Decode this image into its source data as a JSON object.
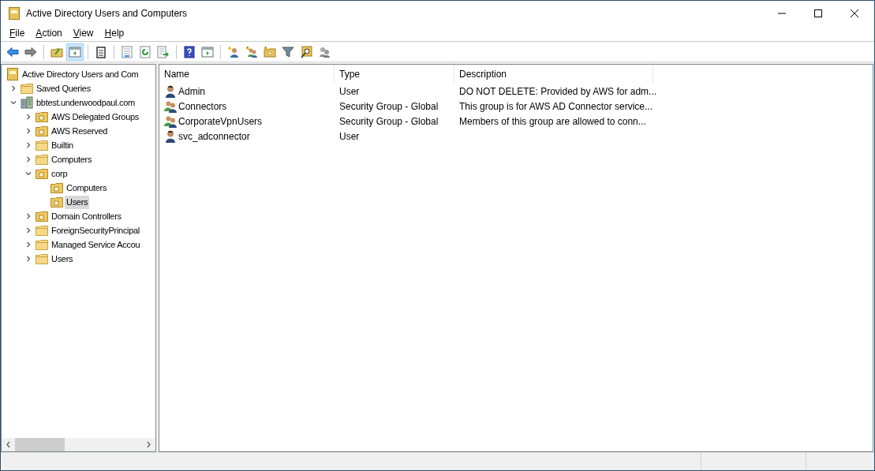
{
  "window": {
    "title": "Active Directory Users and Computers"
  },
  "menu": [
    "File",
    "Action",
    "View",
    "Help"
  ],
  "toolbar": [
    {
      "kind": "back",
      "selected": false
    },
    {
      "kind": "forward",
      "selected": false
    },
    {
      "kind": "sep"
    },
    {
      "kind": "up-folder",
      "selected": false
    },
    {
      "kind": "pane",
      "selected": true
    },
    {
      "kind": "sep"
    },
    {
      "kind": "clipboard",
      "selected": false
    },
    {
      "kind": "sep"
    },
    {
      "kind": "properties",
      "selected": false
    },
    {
      "kind": "refresh",
      "selected": false
    },
    {
      "kind": "export",
      "selected": false
    },
    {
      "kind": "sep"
    },
    {
      "kind": "help",
      "selected": false
    },
    {
      "kind": "pane2",
      "selected": false
    },
    {
      "kind": "sep"
    },
    {
      "kind": "new-user",
      "selected": false
    },
    {
      "kind": "new-group",
      "selected": false
    },
    {
      "kind": "new-ou",
      "selected": false
    },
    {
      "kind": "filter",
      "selected": false
    },
    {
      "kind": "find",
      "selected": false
    },
    {
      "kind": "delegate",
      "selected": false
    }
  ],
  "tree": [
    {
      "label": "Active Directory Users and Com",
      "kind": "root",
      "selected": false,
      "children": [
        {
          "label": "Saved Queries",
          "kind": "folder",
          "expanded": false,
          "selected": false
        },
        {
          "label": "bbtest.underwoodpaul.com",
          "kind": "domain",
          "expanded": true,
          "selected": false,
          "children": [
            {
              "label": "AWS Delegated Groups",
              "kind": "ou",
              "expanded": false,
              "selected": false
            },
            {
              "label": "AWS Reserved",
              "kind": "ou",
              "expanded": false,
              "selected": false
            },
            {
              "label": "Builtin",
              "kind": "folder",
              "expanded": false,
              "selected": false
            },
            {
              "label": "Computers",
              "kind": "folder",
              "expanded": false,
              "selected": false
            },
            {
              "label": "corp",
              "kind": "ou",
              "expanded": true,
              "selected": false,
              "children": [
                {
                  "label": "Computers",
                  "kind": "ou",
                  "selected": false
                },
                {
                  "label": "Users",
                  "kind": "ou",
                  "selected": true
                }
              ]
            },
            {
              "label": "Domain Controllers",
              "kind": "ou",
              "expanded": false,
              "selected": false
            },
            {
              "label": "ForeignSecurityPrincipal",
              "kind": "folder",
              "expanded": false,
              "selected": false
            },
            {
              "label": "Managed Service Accou",
              "kind": "folder",
              "expanded": false,
              "selected": false
            },
            {
              "label": "Users",
              "kind": "folder",
              "expanded": false,
              "selected": false
            }
          ]
        }
      ]
    }
  ],
  "table": {
    "columns": [
      "Name",
      "Type",
      "Description"
    ],
    "rows": [
      {
        "kind": "user",
        "name": "Admin",
        "type": "User",
        "description": "DO NOT DELETE:  Provided by AWS for adm..."
      },
      {
        "kind": "group",
        "name": "Connectors",
        "type": "Security Group - Global",
        "description": "This group is for AWS AD Connector service..."
      },
      {
        "kind": "group",
        "name": "CorporateVpnUsers",
        "type": "Security Group - Global",
        "description": "Members of this group are allowed to conn..."
      },
      {
        "kind": "user",
        "name": "svc_adconnector",
        "type": "User"
      }
    ]
  }
}
